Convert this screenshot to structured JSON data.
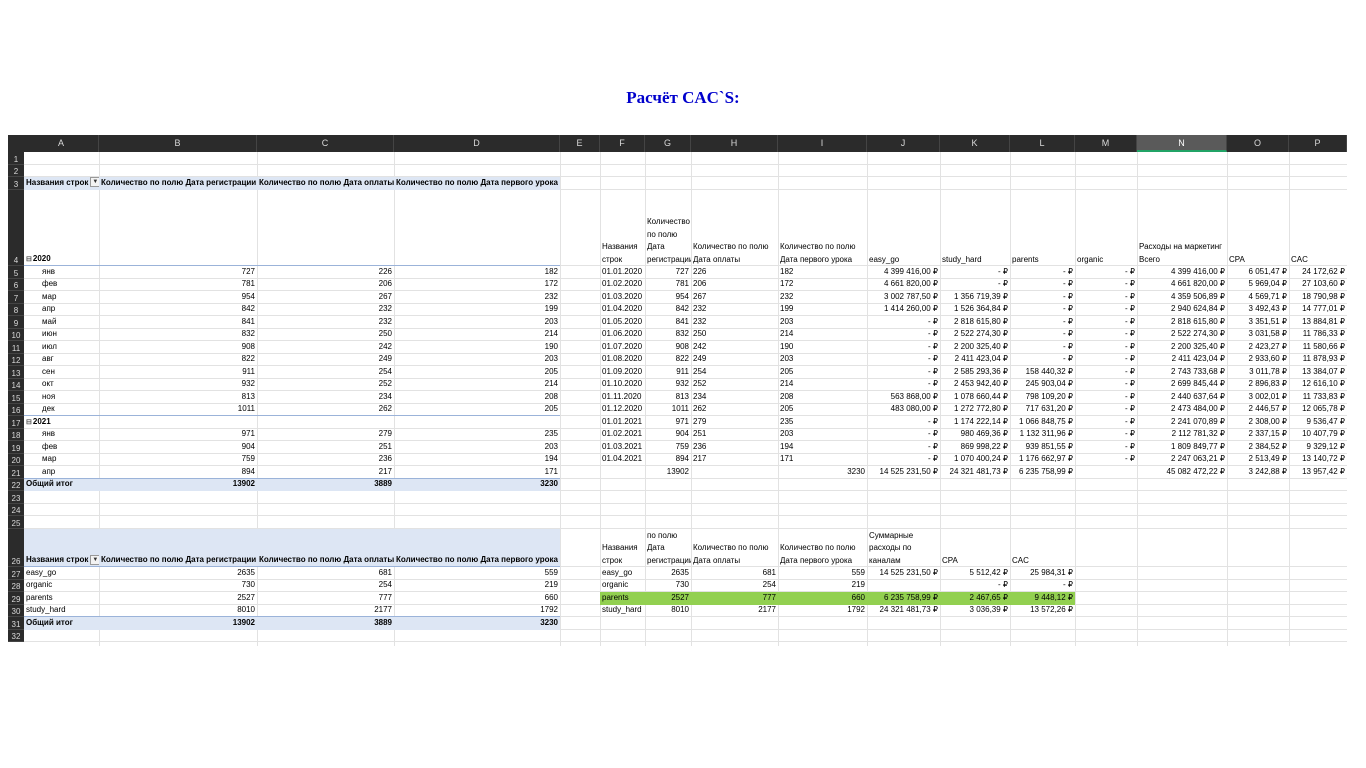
{
  "title": "Расчёт CAC`S:",
  "columns": [
    "A",
    "B",
    "C",
    "D",
    "E",
    "F",
    "G",
    "H",
    "I",
    "J",
    "K",
    "L",
    "M",
    "N",
    "O",
    "P"
  ],
  "row_numbers": [
    "1",
    "2",
    "3",
    "4",
    "5",
    "6",
    "7",
    "8",
    "9",
    "10",
    "11",
    "12",
    "13",
    "14",
    "15",
    "16",
    "17",
    "18",
    "19",
    "20",
    "21",
    "22",
    "23",
    "24",
    "25",
    "26",
    "27",
    "28",
    "29",
    "30",
    "31",
    "32"
  ],
  "pivot1": {
    "headers": [
      "Названия строк",
      "Количество по полю Дата регистрации",
      "Количество по полю Дата оплаты",
      "Количество по полю Дата первого урока"
    ],
    "year2020": "2020",
    "year2021": "2021",
    "rows": [
      [
        "янв",
        "727",
        "226",
        "182"
      ],
      [
        "фев",
        "781",
        "206",
        "172"
      ],
      [
        "мар",
        "954",
        "267",
        "232"
      ],
      [
        "апр",
        "842",
        "232",
        "199"
      ],
      [
        "май",
        "841",
        "232",
        "203"
      ],
      [
        "июн",
        "832",
        "250",
        "214"
      ],
      [
        "июл",
        "908",
        "242",
        "190"
      ],
      [
        "авг",
        "822",
        "249",
        "203"
      ],
      [
        "сен",
        "911",
        "254",
        "205"
      ],
      [
        "окт",
        "932",
        "252",
        "214"
      ],
      [
        "ноя",
        "813",
        "234",
        "208"
      ],
      [
        "дек",
        "1011",
        "262",
        "205"
      ],
      [
        "янв",
        "971",
        "279",
        "235"
      ],
      [
        "фев",
        "904",
        "251",
        "203"
      ],
      [
        "мар",
        "759",
        "236",
        "194"
      ],
      [
        "апр",
        "894",
        "217",
        "171"
      ]
    ],
    "total": [
      "Общий итог",
      "13902",
      "3889",
      "3230"
    ]
  },
  "table1": {
    "headers": [
      "Названия строк",
      "Количество по полю Дата регистрации",
      "Количество по полю Дата оплаты",
      "Количество по полю Дата первого урока",
      "easy_go",
      "study_hard",
      "parents",
      "organic",
      "Расходы на маркетинг Всего",
      "CPA",
      "CAC"
    ],
    "rows": [
      [
        "01.01.2020",
        "727",
        "226",
        "182",
        "4 399 416,00 ₽",
        "-   ₽",
        "-   ₽",
        "-   ₽",
        "4 399 416,00 ₽",
        "6 051,47 ₽",
        "24 172,62 ₽"
      ],
      [
        "01.02.2020",
        "781",
        "206",
        "172",
        "4 661 820,00 ₽",
        "-   ₽",
        "-   ₽",
        "-   ₽",
        "4 661 820,00 ₽",
        "5 969,04 ₽",
        "27 103,60 ₽"
      ],
      [
        "01.03.2020",
        "954",
        "267",
        "232",
        "3 002 787,50 ₽",
        "1 356 719,39 ₽",
        "-   ₽",
        "-   ₽",
        "4 359 506,89 ₽",
        "4 569,71 ₽",
        "18 790,98 ₽"
      ],
      [
        "01.04.2020",
        "842",
        "232",
        "199",
        "1 414 260,00 ₽",
        "1 526 364,84 ₽",
        "-   ₽",
        "-   ₽",
        "2 940 624,84 ₽",
        "3 492,43 ₽",
        "14 777,01 ₽"
      ],
      [
        "01.05.2020",
        "841",
        "232",
        "203",
        "-   ₽",
        "2 818 615,80 ₽",
        "-   ₽",
        "-   ₽",
        "2 818 615,80 ₽",
        "3 351,51 ₽",
        "13 884,81 ₽"
      ],
      [
        "01.06.2020",
        "832",
        "250",
        "214",
        "-   ₽",
        "2 522 274,30 ₽",
        "-   ₽",
        "-   ₽",
        "2 522 274,30 ₽",
        "3 031,58 ₽",
        "11 786,33 ₽"
      ],
      [
        "01.07.2020",
        "908",
        "242",
        "190",
        "-   ₽",
        "2 200 325,40 ₽",
        "-   ₽",
        "-   ₽",
        "2 200 325,40 ₽",
        "2 423,27 ₽",
        "11 580,66 ₽"
      ],
      [
        "01.08.2020",
        "822",
        "249",
        "203",
        "-   ₽",
        "2 411 423,04 ₽",
        "-   ₽",
        "-   ₽",
        "2 411 423,04 ₽",
        "2 933,60 ₽",
        "11 878,93 ₽"
      ],
      [
        "01.09.2020",
        "911",
        "254",
        "205",
        "-   ₽",
        "2 585 293,36 ₽",
        "158 440,32 ₽",
        "-   ₽",
        "2 743 733,68 ₽",
        "3 011,78 ₽",
        "13 384,07 ₽"
      ],
      [
        "01.10.2020",
        "932",
        "252",
        "214",
        "-   ₽",
        "2 453 942,40 ₽",
        "245 903,04 ₽",
        "-   ₽",
        "2 699 845,44 ₽",
        "2 896,83 ₽",
        "12 616,10 ₽"
      ],
      [
        "01.11.2020",
        "813",
        "234",
        "208",
        "563 868,00 ₽",
        "1 078 660,44 ₽",
        "798 109,20 ₽",
        "-   ₽",
        "2 440 637,64 ₽",
        "3 002,01 ₽",
        "11 733,83 ₽"
      ],
      [
        "01.12.2020",
        "1011",
        "262",
        "205",
        "483 080,00 ₽",
        "1 272 772,80 ₽",
        "717 631,20 ₽",
        "-   ₽",
        "2 473 484,00 ₽",
        "2 446,57 ₽",
        "12 065,78 ₽"
      ],
      [
        "01.01.2021",
        "971",
        "279",
        "235",
        "-   ₽",
        "1 174 222,14 ₽",
        "1 066 848,75 ₽",
        "-   ₽",
        "2 241 070,89 ₽",
        "2 308,00 ₽",
        "9 536,47 ₽"
      ],
      [
        "01.02.2021",
        "904",
        "251",
        "203",
        "-   ₽",
        "980 469,36 ₽",
        "1 132 311,96 ₽",
        "-   ₽",
        "2 112 781,32 ₽",
        "2 337,15 ₽",
        "10 407,79 ₽"
      ],
      [
        "01.03.2021",
        "759",
        "236",
        "194",
        "-   ₽",
        "869 998,22 ₽",
        "939 851,55 ₽",
        "-   ₽",
        "1 809 849,77 ₽",
        "2 384,52 ₽",
        "9 329,12 ₽"
      ],
      [
        "01.04.2021",
        "894",
        "217",
        "171",
        "-   ₽",
        "1 070 400,24 ₽",
        "1 176 662,97 ₽",
        "-   ₽",
        "2 247 063,21 ₽",
        "2 513,49 ₽",
        "13 140,72 ₽"
      ]
    ],
    "total": [
      "",
      "13902",
      "",
      "3230",
      "14 525 231,50 ₽",
      "24 321 481,73 ₽",
      "6 235 758,99 ₽",
      "",
      "45 082 472,22 ₽",
      "3 242,88 ₽",
      "13 957,42 ₽"
    ]
  },
  "pivot2": {
    "headers": [
      "Названия строк",
      "Количество по полю Дата регистрации",
      "Количество по полю Дата оплаты",
      "Количество по полю Дата первого урока"
    ],
    "rows": [
      [
        "easy_go",
        "2635",
        "681",
        "559"
      ],
      [
        "organic",
        "730",
        "254",
        "219"
      ],
      [
        "parents",
        "2527",
        "777",
        "660"
      ],
      [
        "study_hard",
        "8010",
        "2177",
        "1792"
      ]
    ],
    "total": [
      "Общий итог",
      "13902",
      "3889",
      "3230"
    ]
  },
  "table2": {
    "headers": [
      "Названия строк",
      "Количество по полю Дата регистрации",
      "Количество по полю Дата оплаты",
      "Количество по полю Дата первого урока",
      "Суммарные расходы по каналам",
      "CPA",
      "CAC"
    ],
    "rows": [
      [
        "easy_go",
        "2635",
        "681",
        "559",
        "14 525 231,50 ₽",
        "5 512,42 ₽",
        "25 984,31 ₽"
      ],
      [
        "organic",
        "730",
        "254",
        "219",
        "",
        "-   ₽",
        "-   ₽"
      ],
      [
        "parents",
        "2527",
        "777",
        "660",
        "6 235 758,99 ₽",
        "2 467,65 ₽",
        "9 448,12 ₽"
      ],
      [
        "study_hard",
        "8010",
        "2177",
        "1792",
        "24 321 481,73 ₽",
        "3 036,39 ₽",
        "13 572,26 ₽"
      ]
    ]
  },
  "colors": {
    "title": "#0000cc",
    "header_dark": "#2b2b2b",
    "pivot_band": "#dde6f4",
    "highlight_green": "#92d050"
  }
}
